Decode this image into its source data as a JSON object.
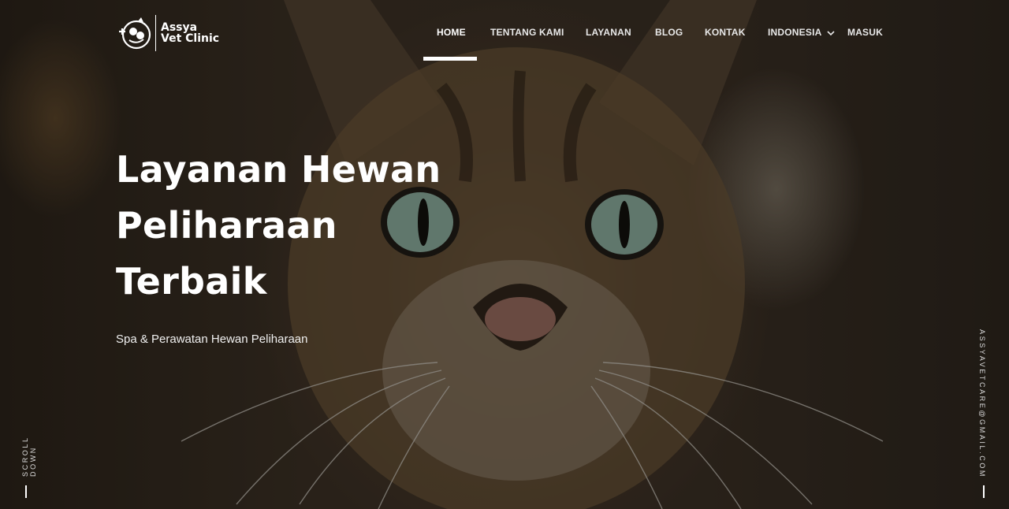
{
  "brand": {
    "line1": "Assya",
    "line2": "Vet Clinic"
  },
  "nav": {
    "items": [
      {
        "label": "HOME",
        "active": true
      },
      {
        "label": "TENTANG KAMI"
      },
      {
        "label": "LAYANAN"
      },
      {
        "label": "BLOG"
      },
      {
        "label": "KONTAK"
      },
      {
        "label": "INDONESIA"
      },
      {
        "label": "MASUK"
      }
    ]
  },
  "hero": {
    "title_line1": "Layanan Hewan",
    "title_line2": "Peliharaan",
    "title_line3": "Terbaik",
    "subtitle": "Spa & Perawatan Hewan Peliharaan"
  },
  "side": {
    "scroll_label": "SCROLL DOWN",
    "email": "ASSYAVETCARE@GMAIL.COM"
  },
  "icons": {
    "logo": "vet-clinic-logo-icon",
    "language_chevron": "chevron-down-icon"
  },
  "colors": {
    "text": "#ffffff",
    "overlay": "#1a1614"
  }
}
